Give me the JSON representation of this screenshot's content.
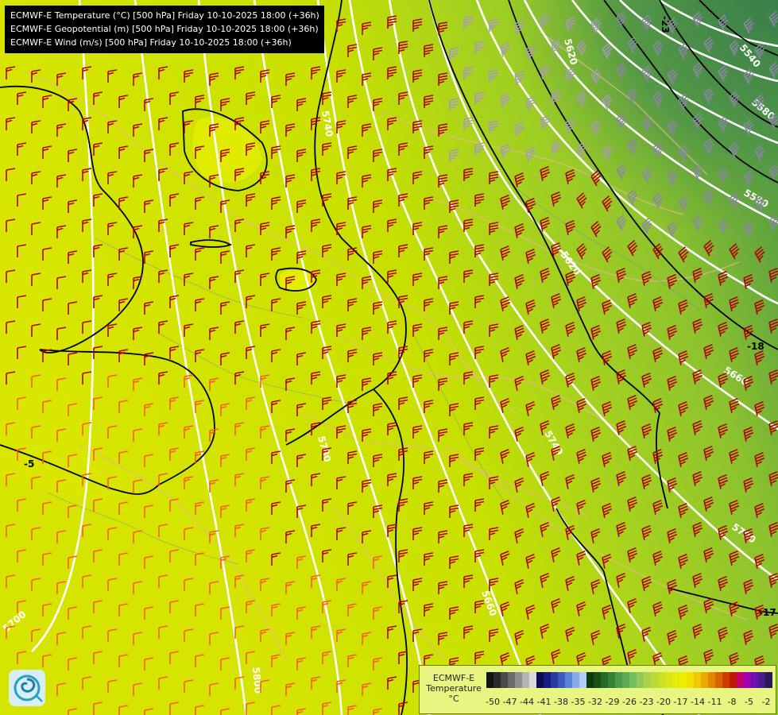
{
  "titles": [
    "ECMWF-E Temperature (°C) [500 hPa] Friday 10-10-2025 18:00 (+36h)",
    "ECMWF-E Geopotential (m) [500 hPa] Friday 10-10-2025 18:00 (+36h)",
    "ECMWF-E Wind (m/s) [500 hPa] Friday 10-10-2025 18:00 (+36h)"
  ],
  "legend": {
    "title_line1": "ECMWF-E",
    "title_line2": "Temperature",
    "unit": "°C",
    "ticks": [
      "-50",
      "-47",
      "-44",
      "-41",
      "-38",
      "-35",
      "-32",
      "-29",
      "-26",
      "-23",
      "-20",
      "-17",
      "-14",
      "-11",
      "-8",
      "-5",
      "-2"
    ],
    "colors": [
      "#141414",
      "#2a2a2a",
      "#4a4a4a",
      "#6a6a6a",
      "#8e8e8e",
      "#b4b4b4",
      "#dadada",
      "#0c0c52",
      "#1a1a80",
      "#2a3aa0",
      "#3a5ac0",
      "#5a82d8",
      "#86aaea",
      "#b0ccf6",
      "#0c3a0c",
      "#195019",
      "#286828",
      "#388038",
      "#4a9a48",
      "#5eaa55",
      "#78bc60",
      "#92c85a",
      "#a8d24a",
      "#bcd83a",
      "#cce02a",
      "#d8e61a",
      "#e4ea0a",
      "#eeee00",
      "#f4e000",
      "#f0c800",
      "#e8aa00",
      "#e08800",
      "#d86400",
      "#cc3c00",
      "#c01800",
      "#c00070",
      "#a000b0",
      "#7010b0",
      "#4a1c8a",
      "#2a1a5a"
    ]
  },
  "contour_labels": {
    "geopotential": [
      "5540",
      "5580",
      "5620",
      "5660",
      "5700",
      "5740",
      "5780",
      "5800",
      "5700",
      "5660",
      "5620",
      "5580",
      "5740"
    ],
    "temperature": [
      "-23",
      "-18",
      "-17",
      "-5"
    ]
  },
  "icons": {
    "logo": "ecmwf-swirl-logo-icon",
    "barb": "wind-barb-icon"
  }
}
